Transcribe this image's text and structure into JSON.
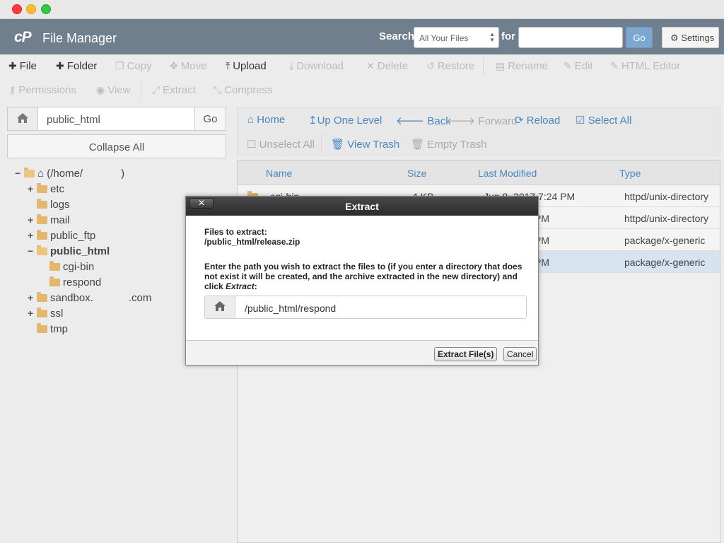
{
  "window": {
    "controls": [
      "close",
      "minimize",
      "maximize"
    ]
  },
  "header": {
    "logo": "cP",
    "title": "File Manager",
    "search_label": "Search",
    "search_scope": "All Your Files",
    "for_label": "for",
    "search_value": "",
    "go_label": "Go",
    "settings_label": "Settings"
  },
  "toolbar": {
    "file": "File",
    "folder": "Folder",
    "copy": "Copy",
    "move": "Move",
    "upload": "Upload",
    "download": "Download",
    "delete": "Delete",
    "restore": "Restore",
    "rename": "Rename",
    "edit": "Edit",
    "html_editor": "HTML Editor",
    "permissions": "Permissions",
    "view": "View",
    "extract": "Extract",
    "compress": "Compress"
  },
  "left": {
    "path_value": "public_html",
    "go_label": "Go",
    "collapse_label": "Collapse All",
    "tree": {
      "root": "(/home/",
      "root_end": ")",
      "etc": "etc",
      "logs": "logs",
      "mail": "mail",
      "public_ftp": "public_ftp",
      "public_html": "public_html",
      "cgi_bin": "cgi-bin",
      "respond": "respond",
      "sandbox": "sandbox.",
      "sandbox_end": ".com",
      "ssl": "ssl",
      "tmp": "tmp"
    }
  },
  "nav": {
    "home": "Home",
    "up": "Up One Level",
    "back": "Back",
    "forward": "Forward",
    "reload": "Reload",
    "select_all": "Select All",
    "unselect_all": "Unselect All",
    "view_trash": "View Trash",
    "empty_trash": "Empty Trash"
  },
  "files": {
    "columns": {
      "name": "Name",
      "size": "Size",
      "modified": "Last Modified",
      "type": "Type"
    },
    "rows": [
      {
        "name": "cgi-bin",
        "size": "4 KB",
        "modified": "Jun 8, 2017 7:24 PM",
        "type": "httpd/unix-directory"
      },
      {
        "name": "",
        "size": "",
        "modified": "PM",
        "type": "httpd/unix-directory"
      },
      {
        "name": "",
        "size": "",
        "modified": "PM",
        "type": "package/x-generic"
      },
      {
        "name": "",
        "size": "",
        "modified": "PM",
        "type": "package/x-generic"
      }
    ]
  },
  "modal": {
    "title": "Extract",
    "close_label": "✕",
    "files_label": "Files to extract:",
    "file_path": "/public_html/release.zip",
    "instructions": "Enter the path you wish to extract the files to (if you enter a directory that does not exist it will be created, and the archive extracted in the new directory) and click",
    "instructions_em": "Extract",
    "instructions_end": ":",
    "path_value": "/public_html/respond",
    "extract_button": "Extract File(s)",
    "cancel_button": "Cancel"
  }
}
